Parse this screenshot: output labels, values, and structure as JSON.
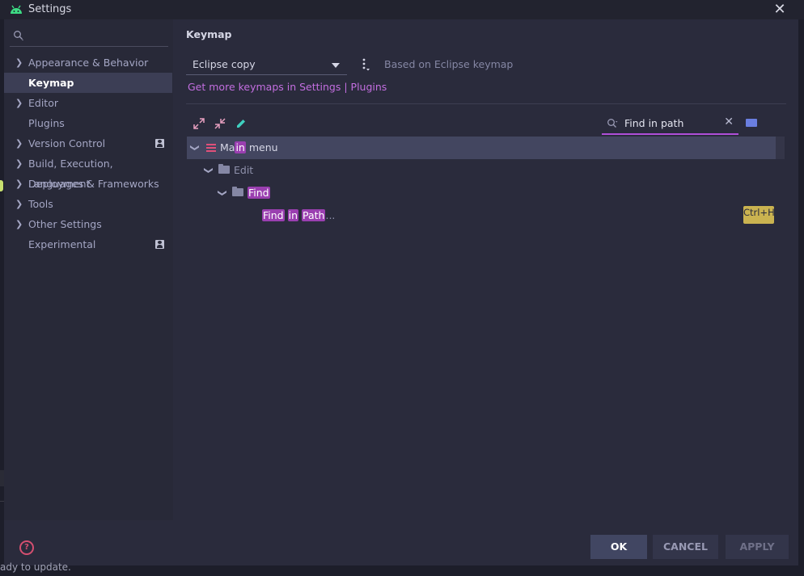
{
  "window": {
    "title": "Settings"
  },
  "sidebar": {
    "search_placeholder": "",
    "items": [
      {
        "label": "Appearance & Behavior",
        "expandable": true,
        "selected": false,
        "badge": false
      },
      {
        "label": "Keymap",
        "expandable": false,
        "selected": true,
        "badge": false
      },
      {
        "label": "Editor",
        "expandable": true,
        "selected": false,
        "badge": false
      },
      {
        "label": "Plugins",
        "expandable": false,
        "selected": false,
        "badge": false
      },
      {
        "label": "Version Control",
        "expandable": true,
        "selected": false,
        "badge": true
      },
      {
        "label": "Build, Execution, Deployment",
        "expandable": true,
        "selected": false,
        "badge": false
      },
      {
        "label": "Languages & Frameworks",
        "expandable": true,
        "selected": false,
        "badge": false
      },
      {
        "label": "Tools",
        "expandable": true,
        "selected": false,
        "badge": false
      },
      {
        "label": "Other Settings",
        "expandable": true,
        "selected": false,
        "badge": false
      },
      {
        "label": "Experimental",
        "expandable": false,
        "selected": false,
        "badge": true
      }
    ]
  },
  "keymap": {
    "heading": "Keymap",
    "selected_keymap": "Eclipse copy",
    "based_on": "Based on Eclipse keymap",
    "more_link": "Get more keymaps in Settings | Plugins",
    "search_value": "Find in path",
    "tree": {
      "main_menu": {
        "pre": "Ma",
        "hl": "in",
        "post": " menu"
      },
      "edit": "Edit",
      "find": {
        "hl": "Find"
      },
      "find_in_path": {
        "hl1": "Find",
        "sp1": " ",
        "hl2": "in",
        "sp2": " ",
        "hl3": "Path",
        "post": "..."
      },
      "shortcut": "Ctrl+H"
    }
  },
  "buttons": {
    "ok": "OK",
    "cancel": "CANCEL",
    "apply": "APPLY"
  },
  "status_bar": {
    "text": "ady to update."
  },
  "colors": {
    "accent": "#b04fd8",
    "highlight": "#9a3fb0",
    "shortcut_bg": "#cab350",
    "selection": "#434660"
  }
}
